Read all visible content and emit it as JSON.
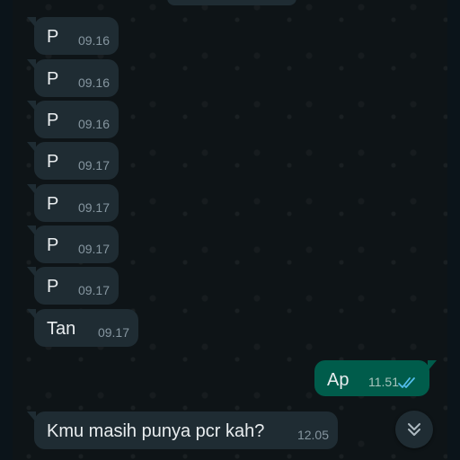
{
  "messages": [
    {
      "text": "P",
      "time": "09.16",
      "direction": "incoming"
    },
    {
      "text": "P",
      "time": "09.16",
      "direction": "incoming"
    },
    {
      "text": "P",
      "time": "09.16",
      "direction": "incoming"
    },
    {
      "text": "P",
      "time": "09.17",
      "direction": "incoming"
    },
    {
      "text": "P",
      "time": "09.17",
      "direction": "incoming"
    },
    {
      "text": "P",
      "time": "09.17",
      "direction": "incoming"
    },
    {
      "text": "P",
      "time": "09.17",
      "direction": "incoming"
    },
    {
      "text": "Tan",
      "time": "09.17",
      "direction": "incoming"
    },
    {
      "text": "Ap",
      "time": "11.51",
      "direction": "outgoing",
      "status_icon": "double-check-read-icon"
    },
    {
      "text": "Kmu masih punya pcr kah?",
      "time": "12.05",
      "direction": "incoming"
    }
  ],
  "scroll_button": {
    "icon": "double-chevron-down-icon"
  },
  "colors": {
    "incoming_bubble": "#1f2c33",
    "outgoing_bubble": "#005c4b",
    "text": "#e9edef",
    "timestamp": "#8696a0",
    "read_ticks": "#53bdeb"
  }
}
